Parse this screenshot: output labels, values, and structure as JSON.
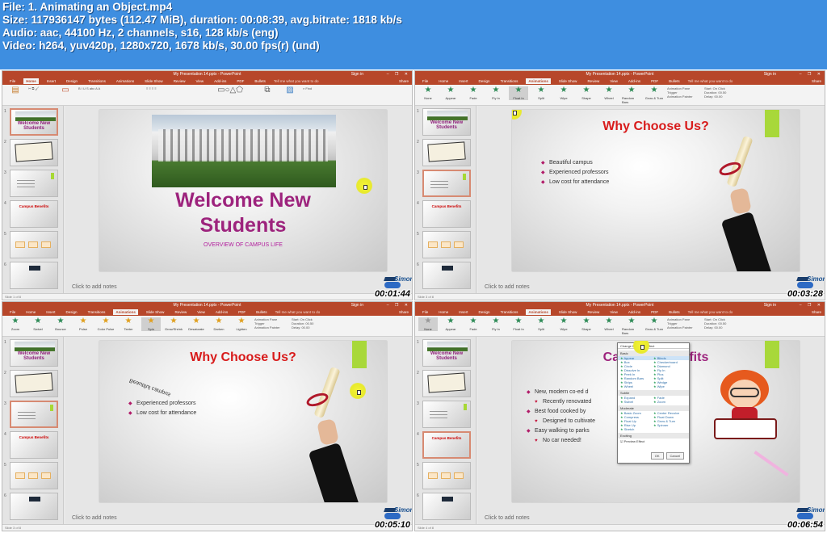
{
  "info": {
    "file": "File: 1. Animating an Object.mp4",
    "size": "Size: 117936147 bytes (112.47 MiB), duration: 00:08:39, avg.bitrate: 1818 kb/s",
    "audio": "Audio: aac, 44100 Hz, 2 channels, s16, 128 kb/s (eng)",
    "video": "Video: h264, yuv420p, 1280x720, 1678 kb/s, 30.00 fps(r) (und)"
  },
  "app": {
    "window_title": "My Presentation 14.pptx - PowerPoint",
    "sign_in": "Sign in",
    "tell_me": "Tell me what you want to do",
    "share": "Share",
    "notes_placeholder": "Click to add notes",
    "brand": "Simon",
    "tabs": [
      "File",
      "Home",
      "Insert",
      "Design",
      "Transitions",
      "Animations",
      "Slide Show",
      "Review",
      "View",
      "Add-ins",
      "PDF",
      "Bullets"
    ],
    "effects": [
      "None",
      "Appear",
      "Fade",
      "Fly In",
      "Float In",
      "Split",
      "Wipe",
      "Shape",
      "Wheel",
      "Random Bars",
      "Grow & Turn"
    ],
    "effects2": [
      "Zoom",
      "Swivel",
      "Bounce",
      "Pulse",
      "Color Pulse",
      "Teeter",
      "Spin",
      "Grow/Shrink",
      "Desaturate",
      "Darken",
      "Lighten"
    ],
    "timing": {
      "start": "Start: On Click",
      "duration": "Duration: 00.50",
      "delay": "Delay: 00.00"
    },
    "adv": {
      "pane": "Animation Pane",
      "trigger": "Trigger",
      "painter": "Animation Painter"
    }
  },
  "frames": [
    {
      "timestamp": "00:01:44",
      "active_tab": "Home",
      "selected_slide": 1
    },
    {
      "timestamp": "00:03:28",
      "active_tab": "Animations",
      "selected_slide": 3
    },
    {
      "timestamp": "00:05:10",
      "active_tab": "Animations",
      "selected_slide": 3
    },
    {
      "timestamp": "00:06:54",
      "active_tab": "Animations",
      "selected_slide": 4
    }
  ],
  "slides": {
    "welcome": {
      "title_l1": "Welcome New",
      "title_l2": "Students",
      "subtitle": "OVERVIEW OF CAMPUS LIFE"
    },
    "why": {
      "title": "Why Choose Us?",
      "bullets": [
        "Beautiful campus",
        "Experienced professors",
        "Low cost for attendance"
      ]
    },
    "campus": {
      "title": "Campus Benefits",
      "bullets": [
        {
          "t": "New, modern co-ed d",
          "sub": false
        },
        {
          "t": "Recently renovated",
          "sub": true
        },
        {
          "t": "Best food cooked by",
          "sub": false
        },
        {
          "t": "Designed to cultivate",
          "sub": true
        },
        {
          "t": "Easy walking to parks",
          "sub": false
        },
        {
          "t": "No car needed!",
          "sub": true
        }
      ]
    }
  },
  "dialog": {
    "title": "Change Entrance Effect",
    "basic": "Basic",
    "subtle": "Subtle",
    "moderate": "Moderate",
    "exciting": "Exciting",
    "items": [
      [
        "Appear",
        "Blinds"
      ],
      [
        "Box",
        "Checkerboard"
      ],
      [
        "Circle",
        "Diamond"
      ],
      [
        "Dissolve In",
        "Fly In"
      ],
      [
        "Peek In",
        "Plus"
      ],
      [
        "Random Bars",
        "Split"
      ],
      [
        "Strips",
        "Wedge"
      ],
      [
        "Wheel",
        "Wipe"
      ]
    ],
    "subtle_items": [
      [
        "Expand",
        "Fade"
      ],
      [
        "Swivel",
        "Zoom"
      ]
    ],
    "moderate_items": [
      [
        "Basic Zoom",
        "Center Revolve"
      ],
      [
        "Compress",
        "Float Down"
      ],
      [
        "Float Up",
        "Grow & Turn"
      ],
      [
        "Rise Up",
        "Spinner"
      ],
      [
        "Stretch",
        ""
      ]
    ],
    "preview": "Preview Effect",
    "ok": "OK",
    "cancel": "Cancel"
  },
  "thumb_labels": {
    "welcome": "Welcome New Students",
    "why": "Why Choose Us?",
    "campus": "Campus Benefits"
  }
}
